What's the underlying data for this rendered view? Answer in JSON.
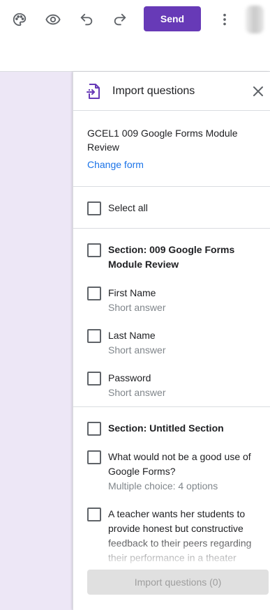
{
  "toolbar": {
    "icons": [
      "palette-icon",
      "preview-eye-icon",
      "undo-icon",
      "redo-icon",
      "more-vert-icon"
    ],
    "send_label": "Send",
    "accent_color": "#673ab7"
  },
  "panel": {
    "title": "Import questions",
    "form_name": "GCEL1 009 Google Forms Module Review",
    "change_form_label": "Change form",
    "select_all_label": "Select all",
    "items": [
      {
        "label": "Section: 009 Google Forms Module Review",
        "type": "section"
      },
      {
        "label": "First Name",
        "sub": "Short answer"
      },
      {
        "label": "Last Name",
        "sub": "Short answer"
      },
      {
        "label": "Password",
        "sub": "Short answer"
      },
      {
        "label": "Section: Untitled Section",
        "type": "section"
      },
      {
        "label": "What would not be a good use of Google Forms?",
        "sub": "Multiple choice: 4 options"
      },
      {
        "label": "A teacher wants her students to provide honest but constructive feedback to their peers regarding their performance in a theater"
      }
    ],
    "import_button_label": "Import questions (0)"
  }
}
